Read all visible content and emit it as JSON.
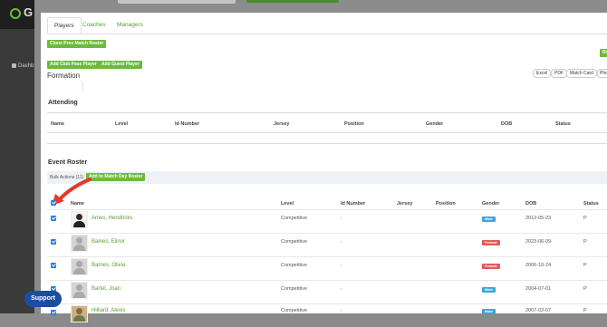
{
  "sidebar": {
    "logo_letter": "G",
    "dashboard_label": "Dashb"
  },
  "tabs": [
    {
      "label": "Players"
    },
    {
      "label": "Coaches"
    },
    {
      "label": "Managers"
    }
  ],
  "actions": {
    "clone_label": "Clone Prev Match Roster",
    "add_club_pass_label": "Add Club Pass Player",
    "add_guest_label": "Add Guest Player",
    "right_green_label": "Ru",
    "exports": [
      "Excel",
      "PDF",
      "Match Card",
      "Pho"
    ]
  },
  "formation_label": "Formation",
  "attending": {
    "title": "Attending",
    "columns": [
      "Name",
      "Level",
      "Id Number",
      "Jersey",
      "Position",
      "Gender",
      "DOB",
      "Status"
    ]
  },
  "roster": {
    "title": "Event Roster",
    "bulk_label": "Bulk Actions (11)",
    "add_match_day_label": "Add to Match Day Roster",
    "columns": [
      "Name",
      "Level",
      "Id Number",
      "Jersey",
      "Position",
      "Gender",
      "DOB",
      "Status"
    ],
    "rows": [
      {
        "name": "Ames, Hendricks",
        "level": "Competitive",
        "id": ",",
        "gender": "Male",
        "dob": "2012-05-23",
        "status": "P"
      },
      {
        "name": "Baines, Elinor",
        "level": "Competitive",
        "id": ",",
        "gender": "Female",
        "dob": "2023-06-09",
        "status": "P"
      },
      {
        "name": "Barnes, Olivia",
        "level": "Competitive",
        "id": ",",
        "gender": "Female",
        "dob": "2006-10-24",
        "status": "P"
      },
      {
        "name": "Bartel, Joan",
        "level": "Competitive",
        "id": ",",
        "gender": "Male",
        "dob": "2004-07-01",
        "status": "P"
      },
      {
        "name": "Hilliard, Alexis",
        "level": "Competitive",
        "id": ",",
        "gender": "Male",
        "dob": "2007-02-07",
        "status": "P"
      }
    ]
  },
  "colors": {
    "male": "#3aa6d8",
    "female": "#e05a5a",
    "green": "#6cbb3c",
    "arrow": "#e53a27"
  },
  "support_label": "Support"
}
